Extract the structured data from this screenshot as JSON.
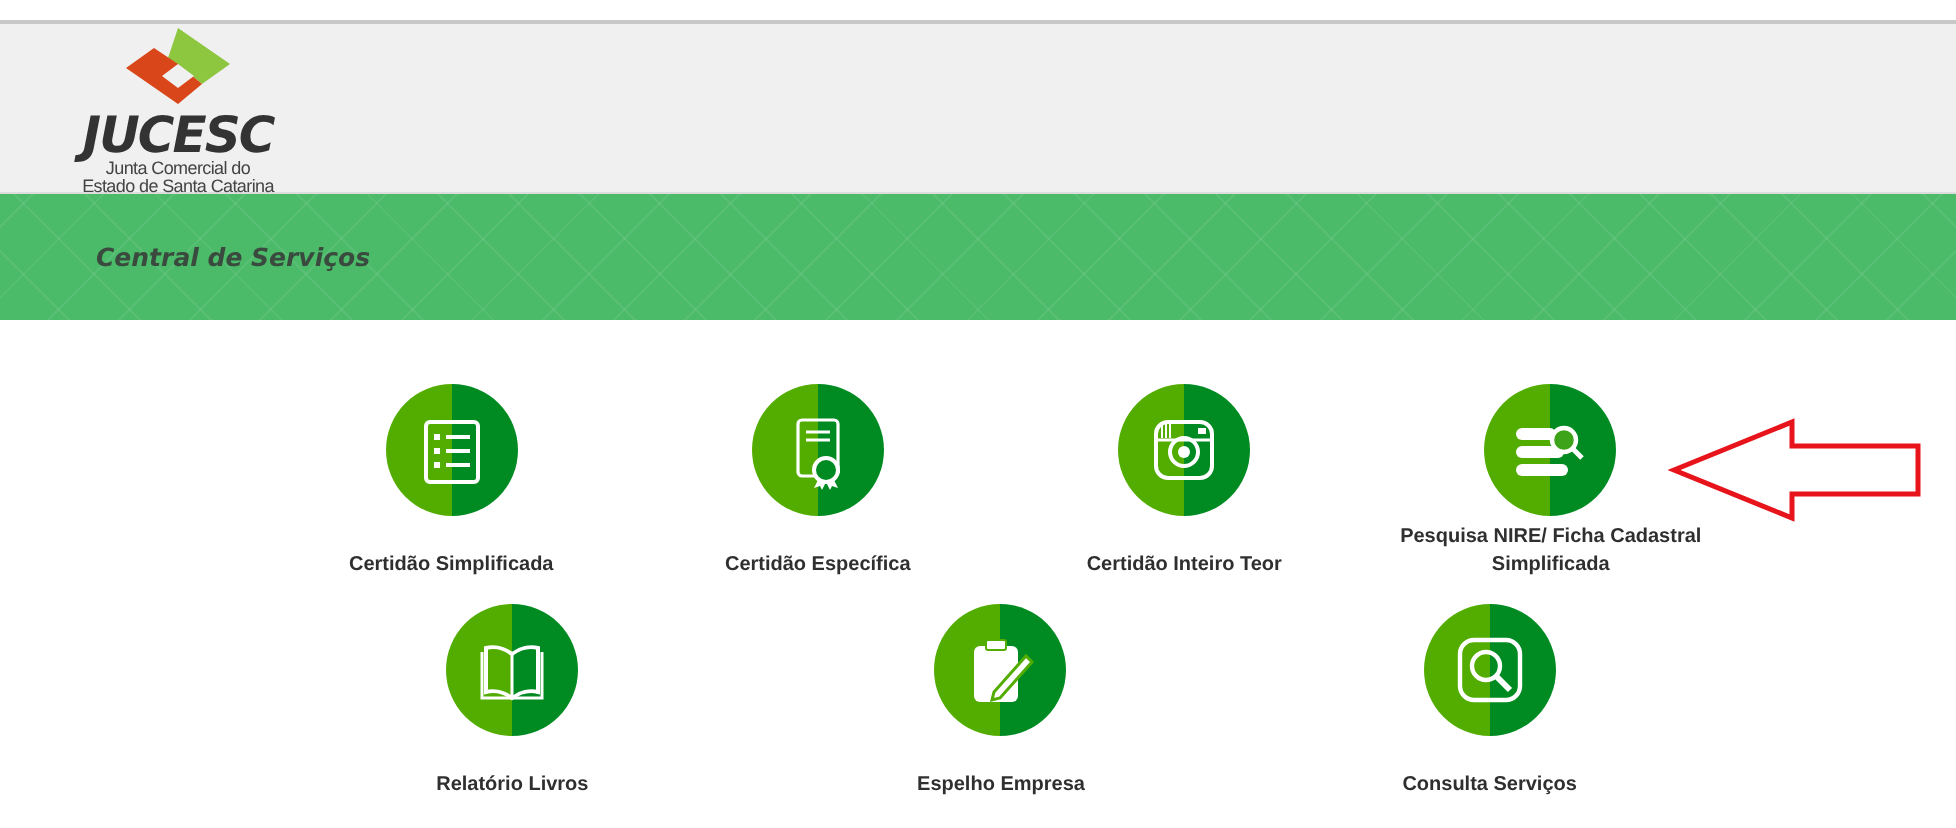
{
  "logo": {
    "name": "JUCESC",
    "subtitle_lines": [
      "Junta Comercial do",
      "Estado de Santa Catarina"
    ]
  },
  "banner": {
    "title": "Central de Serviços"
  },
  "service_rows": [
    [
      {
        "label": "Certidão Simplificada",
        "pointed": false
      },
      {
        "label": "Certidão Específica",
        "pointed": false
      },
      {
        "label": "Certidão Inteiro Teor",
        "pointed": false
      },
      {
        "label": "Pesquisa NIRE/ Ficha Cadastral Simplificada",
        "pointed": true
      }
    ],
    [
      {
        "label": "Relatório Livros",
        "pointed": false
      },
      {
        "label": "Espelho Empresa",
        "pointed": false
      },
      {
        "label": "Consulta Serviços",
        "pointed": false
      }
    ]
  ]
}
